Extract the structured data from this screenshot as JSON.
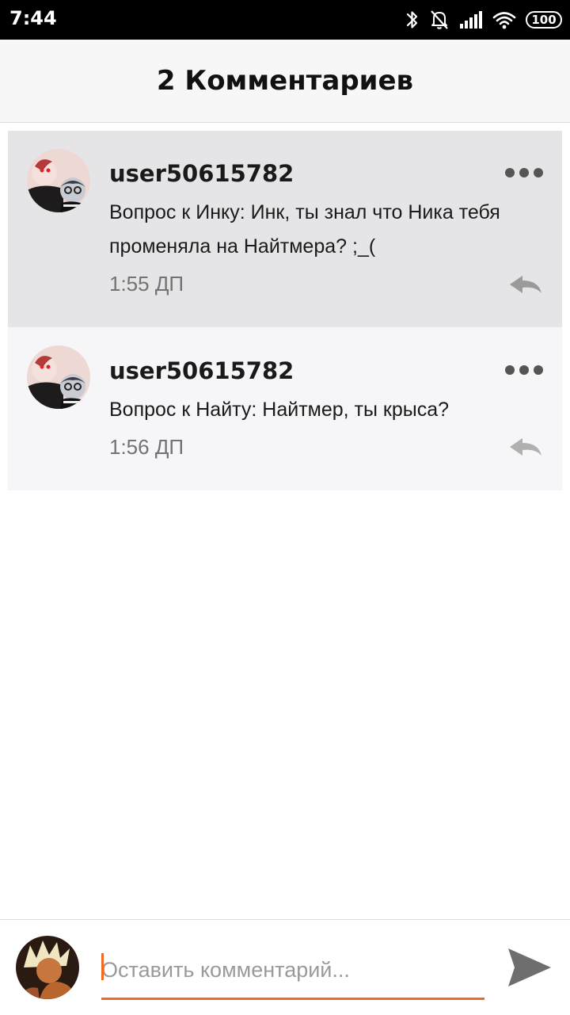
{
  "status_bar": {
    "time": "7:44",
    "battery": "100"
  },
  "header": {
    "title": "2 Комментариев"
  },
  "comments": [
    {
      "username": "user50615782",
      "text": "Вопрос к Инку: Инк, ты знал что Ника тебя променяла на Найтмера? ;_(",
      "time": "1:55 ДП"
    },
    {
      "username": "user50615782",
      "text": "Вопрос к Найту: Найтмер, ты крыса?",
      "time": "1:56 ДП"
    }
  ],
  "input": {
    "placeholder": "Оставить комментарий..."
  },
  "colors": {
    "accent": "#f06a22",
    "highlight_bg": "#e5e4e6",
    "comment_bg": "#f6f5f8"
  },
  "icons": {
    "status": [
      "bluetooth-icon",
      "mute-icon",
      "signal-icon",
      "wifi-icon",
      "battery-icon"
    ],
    "comment": [
      "more-icon",
      "reply-icon"
    ],
    "input": [
      "send-icon"
    ]
  }
}
